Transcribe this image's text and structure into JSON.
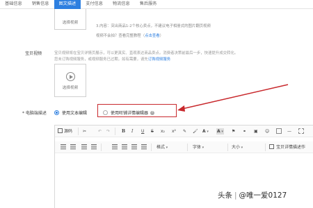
{
  "tabs": [
    {
      "label": "基础信息",
      "active": false
    },
    {
      "label": "销售信息",
      "active": false
    },
    {
      "label": "图文描述",
      "active": true
    },
    {
      "label": "支付信息",
      "active": false
    },
    {
      "label": "物流信息",
      "active": false
    },
    {
      "label": "售后服务",
      "active": false
    }
  ],
  "top_video": {
    "select_label": "选择视频"
  },
  "tips": {
    "line1": "3.内容：突出商品1-2个核心卖点，不建议电子相册式的图片翻页视频",
    "line2_prefix": "视频不会拍？查看完整教程（",
    "line2_link": "点击查看",
    "line2_suffix": "）"
  },
  "baby_video": {
    "label": "宝贝视频",
    "desc1": "宝贝视频将在宝贝详情页展示，可以更真实、直观表达商品卖点。消费者决策前最后一步，快速提升成交转化。",
    "desc2_prefix": "您未订购视频服务，或视频服务已过期，如有需要，请先",
    "desc2_link": "订购视频服务",
    "select_label": "选择视频"
  },
  "pc_desc": {
    "label": "* 电脑端描述",
    "option_text_editor": "使用文本编辑",
    "option_wangpu_editor": "使用旺铺详情编辑器",
    "selected": "使用文本编辑",
    "help_glyph": "?"
  },
  "editor": {
    "source_label": "源码",
    "format_label": "格式",
    "font_label": "字体",
    "size_label": "大小",
    "bold": "B",
    "italic": "I",
    "underline": "U",
    "strike": "S",
    "sub": "x₂",
    "sup": "x²",
    "template_label": "宝贝详情描述作"
  },
  "watermark": {
    "source": "头条",
    "author": "@唯一爱0127"
  },
  "colors": {
    "accent": "#2d7fe0",
    "highlight": "#c8282c"
  }
}
